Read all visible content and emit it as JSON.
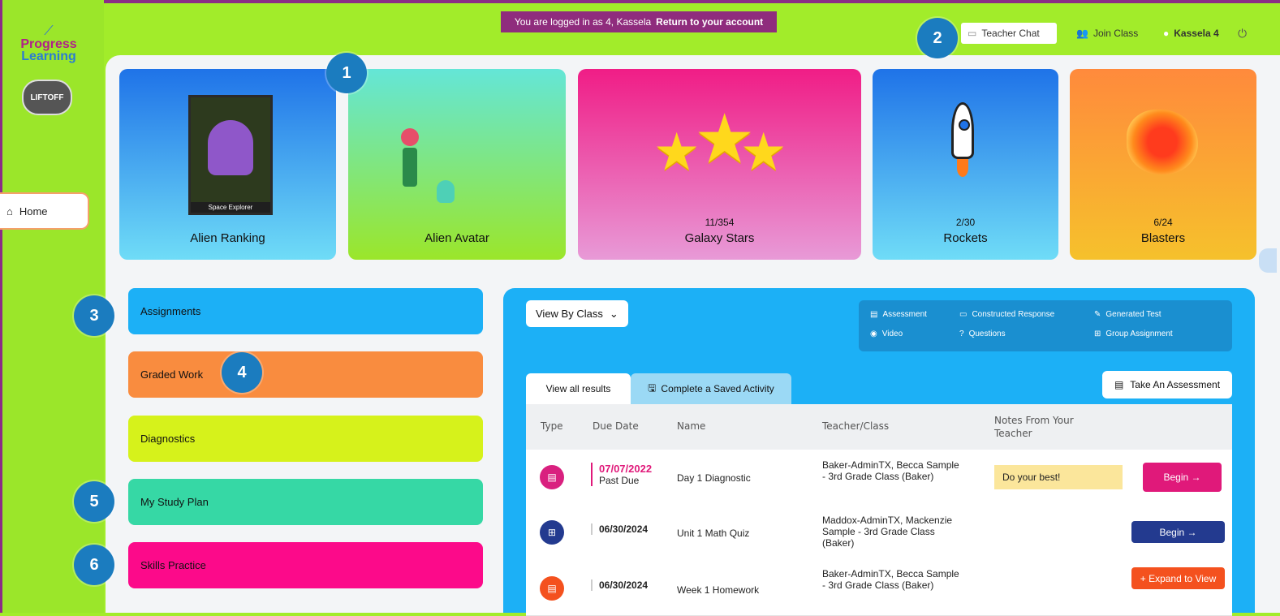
{
  "banner": {
    "text": "You are logged in as 4, Kassela",
    "link": "Return to your account"
  },
  "logo": {
    "line1": "Progress",
    "line2": "Learning",
    "liftoff": "LIFTOFF"
  },
  "nav": {
    "home": "Home"
  },
  "topnav": {
    "teacher_chat": "Teacher Chat",
    "join_class": "Join Class",
    "user": "Kassela 4"
  },
  "cards": {
    "rank": {
      "title": "Alien Ranking",
      "poster_caption": "Space Explorer"
    },
    "avatar": {
      "title": "Alien Avatar"
    },
    "stars": {
      "title": "Galaxy Stars",
      "count": "11/354"
    },
    "rockets": {
      "title": "Rockets",
      "count": "2/30"
    },
    "blasters": {
      "title": "Blasters",
      "count": "6/24"
    }
  },
  "menu": {
    "assignments": "Assignments",
    "graded": "Graded Work",
    "diagnostics": "Diagnostics",
    "study": "My Study Plan",
    "skills": "Skills Practice"
  },
  "badges": [
    "1",
    "2",
    "3",
    "4",
    "5",
    "6"
  ],
  "panel": {
    "view_by": "View By Class",
    "legend": {
      "assessment": "Assessment",
      "constructed": "Constructed Response",
      "generated": "Generated Test",
      "video": "Video",
      "questions": "Questions",
      "group": "Group Assignment"
    },
    "tab_all": "View all results",
    "tab_saved": "Complete a Saved Activity",
    "take": "Take An Assessment",
    "headers": {
      "type": "Type",
      "due": "Due Date",
      "name": "Name",
      "teacher": "Teacher/Class",
      "notes": "Notes From Your Teacher"
    },
    "rows": [
      {
        "due": "07/07/2022",
        "status": "Past Due",
        "name": "Day 1 Diagnostic",
        "teacher": "Baker-AdminTX, Becca Sample - 3rd Grade Class (Baker)",
        "notes": "Do your best!",
        "action": "Begin →"
      },
      {
        "due": "06/30/2024",
        "status": "",
        "name": "Unit 1 Math Quiz",
        "teacher": "Maddox-AdminTX, Mackenzie Sample - 3rd Grade Class (Baker)",
        "notes": "",
        "action": "Begin →"
      },
      {
        "due": "06/30/2024",
        "status": "",
        "name": "Week 1 Homework",
        "teacher": "Baker-AdminTX, Becca Sample - 3rd Grade Class (Baker)",
        "notes": "",
        "action": "+ Expand to View"
      }
    ]
  },
  "colors": {
    "brand_green": "#a2ec2a",
    "banner_purple": "#8f2c7d",
    "assign_blue": "#1cb0f6",
    "badge_blue": "#1b7cbf",
    "begin_pink": "#e0197a",
    "begin_navy": "#233a8f",
    "expand_orange": "#f4511e"
  }
}
